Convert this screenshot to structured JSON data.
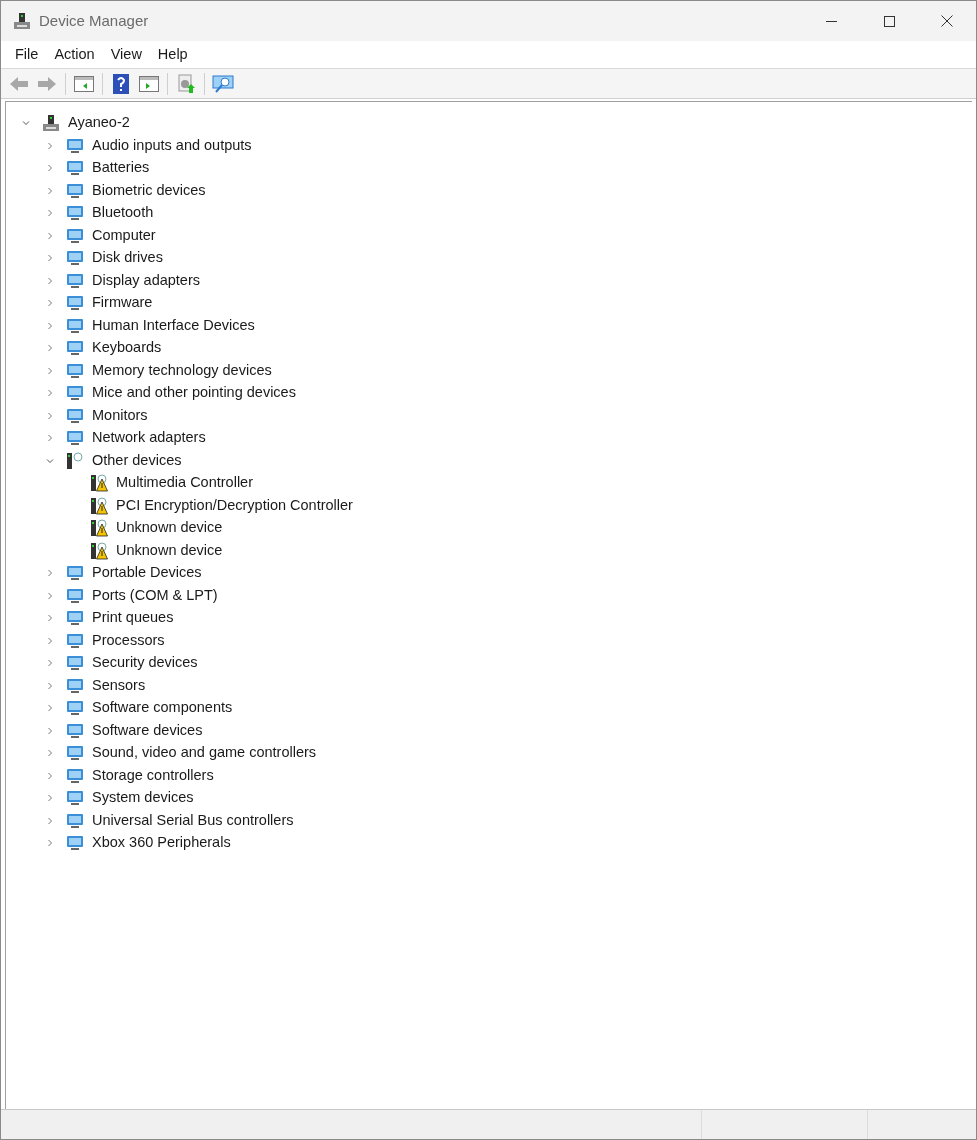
{
  "window": {
    "title": "Device Manager"
  },
  "menu": [
    "File",
    "Action",
    "View",
    "Help"
  ],
  "toolbar": [
    {
      "kind": "back",
      "disabled": true
    },
    {
      "kind": "forward",
      "disabled": true
    },
    {
      "kind": "separator"
    },
    {
      "kind": "show-hide"
    },
    {
      "kind": "separator"
    },
    {
      "kind": "help"
    },
    {
      "kind": "action-pane"
    },
    {
      "kind": "separator"
    },
    {
      "kind": "update-driver"
    },
    {
      "kind": "separator"
    },
    {
      "kind": "scan"
    }
  ],
  "tree": {
    "label": "Ayaneo-2",
    "expanded": true,
    "children": [
      {
        "label": "Audio inputs and outputs",
        "expanded": false
      },
      {
        "label": "Batteries",
        "expanded": false
      },
      {
        "label": "Biometric devices",
        "expanded": false
      },
      {
        "label": "Bluetooth",
        "expanded": false
      },
      {
        "label": "Computer",
        "expanded": false
      },
      {
        "label": "Disk drives",
        "expanded": false
      },
      {
        "label": "Display adapters",
        "expanded": false
      },
      {
        "label": "Firmware",
        "expanded": false
      },
      {
        "label": "Human Interface Devices",
        "expanded": false
      },
      {
        "label": "Keyboards",
        "expanded": false
      },
      {
        "label": "Memory technology devices",
        "expanded": false
      },
      {
        "label": "Mice and other pointing devices",
        "expanded": false
      },
      {
        "label": "Monitors",
        "expanded": false
      },
      {
        "label": "Network adapters",
        "expanded": false
      },
      {
        "label": "Other devices",
        "expanded": true,
        "children": [
          {
            "label": "Multimedia Controller",
            "warning": true
          },
          {
            "label": "PCI Encryption/Decryption Controller",
            "warning": true
          },
          {
            "label": "Unknown device",
            "warning": true
          },
          {
            "label": "Unknown device",
            "warning": true
          }
        ]
      },
      {
        "label": "Portable Devices",
        "expanded": false
      },
      {
        "label": "Ports (COM & LPT)",
        "expanded": false
      },
      {
        "label": "Print queues",
        "expanded": false
      },
      {
        "label": "Processors",
        "expanded": false
      },
      {
        "label": "Security devices",
        "expanded": false
      },
      {
        "label": "Sensors",
        "expanded": false
      },
      {
        "label": "Software components",
        "expanded": false
      },
      {
        "label": "Software devices",
        "expanded": false
      },
      {
        "label": "Sound, video and game controllers",
        "expanded": false
      },
      {
        "label": "Storage controllers",
        "expanded": false
      },
      {
        "label": "System devices",
        "expanded": false
      },
      {
        "label": "Universal Serial Bus controllers",
        "expanded": false
      },
      {
        "label": "Xbox 360 Peripherals",
        "expanded": false
      }
    ]
  }
}
